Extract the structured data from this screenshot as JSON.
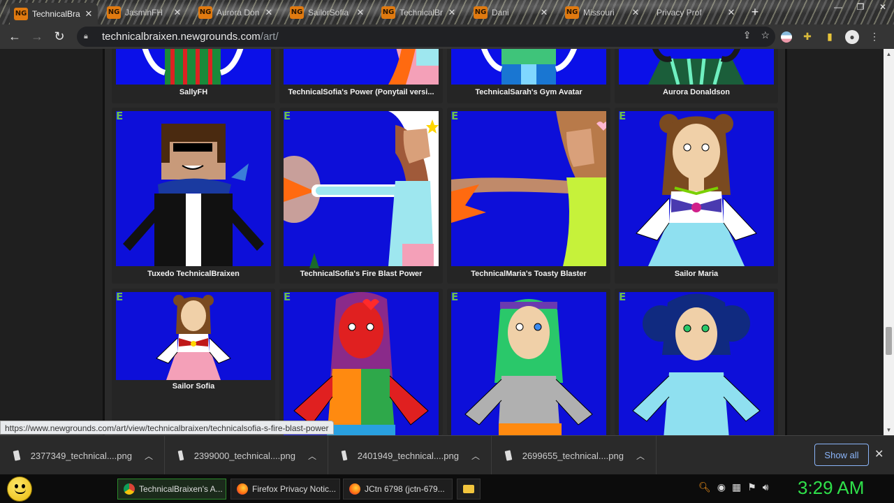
{
  "browser": {
    "tabs": [
      {
        "title": "TechnicalBra",
        "active": true
      },
      {
        "title": "JasminFH",
        "active": false
      },
      {
        "title": "Aurora Don",
        "active": false
      },
      {
        "title": "SailorSofia",
        "active": false
      },
      {
        "title": "TechnicalBr",
        "active": false
      },
      {
        "title": "Dani",
        "active": false
      },
      {
        "title": "Missouri",
        "active": false
      },
      {
        "title": "Privacy Prof",
        "active": false
      }
    ],
    "new_tab": "+",
    "url_host": "technicalbraixen.newgrounds.com",
    "url_path": "/art/"
  },
  "gallery": {
    "row1": [
      {
        "title": "SallyFH"
      },
      {
        "title": "TechnicalSofia's Power (Ponytail versi..."
      },
      {
        "title": "TechnicalSarah's Gym Avatar"
      },
      {
        "title": "Aurora Donaldson"
      }
    ],
    "row2": [
      {
        "title": "Tuxedo TechnicalBraixen",
        "badge": "E"
      },
      {
        "title": "TechnicalSofia's Fire Blast Power",
        "badge": "E"
      },
      {
        "title": "TechnicalMaria's Toasty Blaster",
        "badge": "E"
      },
      {
        "title": "Sailor Maria",
        "badge": "E"
      }
    ],
    "row3": [
      {
        "title": "Sailor Sofia",
        "badge": "E"
      },
      {
        "title": "",
        "badge": "E"
      },
      {
        "title": "",
        "badge": "E"
      },
      {
        "title": "",
        "badge": "E"
      }
    ]
  },
  "status_url": "https://www.newgrounds.com/art/view/technicalbraixen/technicalsofia-s-fire-blast-power",
  "downloads": [
    {
      "filename": "2377349_technical....png"
    },
    {
      "filename": "2399000_technical....png"
    },
    {
      "filename": "2401949_technical....png"
    },
    {
      "filename": "2699655_technical....png"
    }
  ],
  "show_all_label": "Show all",
  "taskbar": {
    "buttons": [
      {
        "label": "TechnicalBraixen's A...",
        "icon": "chrome-icon"
      },
      {
        "label": "Firefox Privacy Notic...",
        "icon": "firefox-icon"
      },
      {
        "label": "JCtn 6798 (jctn-679...",
        "icon": "firefox-icon"
      }
    ],
    "clock": "3:29 AM"
  }
}
